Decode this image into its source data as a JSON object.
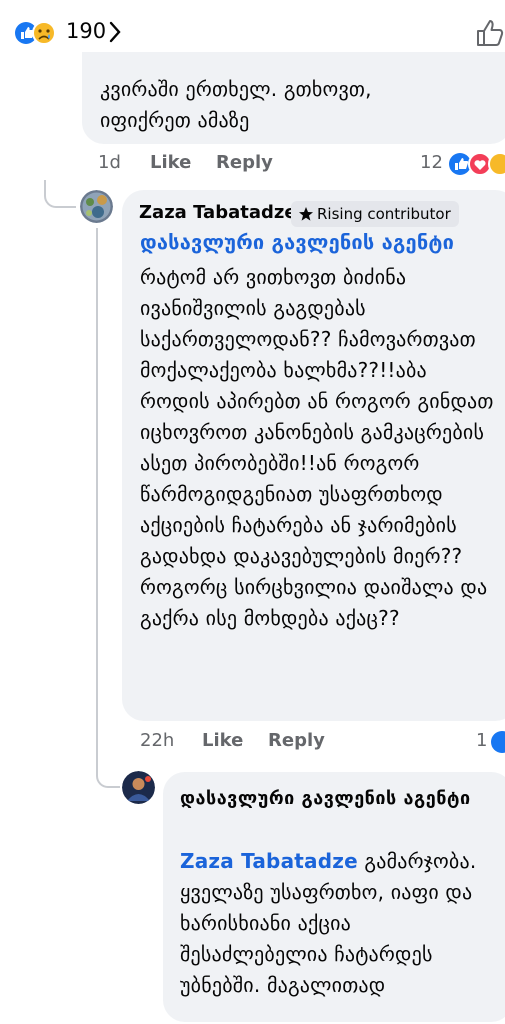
{
  "header": {
    "reaction_count": "190",
    "icons": [
      "like-reaction-icon",
      "sad-reaction-icon",
      "chevron-right-icon",
      "like-thumb-icon"
    ]
  },
  "comment1": {
    "text_lines": [
      "კვირაში ერთხელ. გთხოვთ,",
      "იფიქრეთ ამაზე"
    ],
    "time": "1d",
    "like": "Like",
    "reply": "Reply",
    "reactions": "12"
  },
  "comment2": {
    "author": "Zaza Tabatadze",
    "badge": "Rising contributor",
    "mention": "დასავლური გავლენის აგენტი",
    "text": "რატომ არ ვითხოვთ ბიძინა ივანიშვილის გაგდებას საქართველოდან?? ჩამოვართვათ მოქალაქეობა ხალხმა??!!აბა როდის აპირებთ ან როგორ გინდათ იცხოვროთ კანონების გამკაცრების ასეთ პირობებში!!ან როგორ წარმოგიდგენიათ უსაფრთხოდ აქციების ჩატარება ან ჯარიმების გადახდა დაკავებულების მიერ?? როგორც სირცხვილია დაიშალა და გაქრა ისე მოხდება აქაც??",
    "time": "22h",
    "like": "Like",
    "reply": "Reply",
    "reactions": "1"
  },
  "reply1": {
    "author": "დასავლური გავლენის აგენტი",
    "mention": "Zaza Tabatadze",
    "text": " გამარჯობა. ყველაზე უსაფრთხო, იაფი და ხარისხიანი აქცია შესაძლებელია ჩატარდეს უბნებში. მაგალითად"
  },
  "colors": {
    "bubble": "#f0f2f5",
    "link": "#1b64da",
    "meta": "#65676b",
    "like_blue": "#1877f2",
    "love_red": "#f33e58",
    "sad_yellow": "#f7b928"
  }
}
